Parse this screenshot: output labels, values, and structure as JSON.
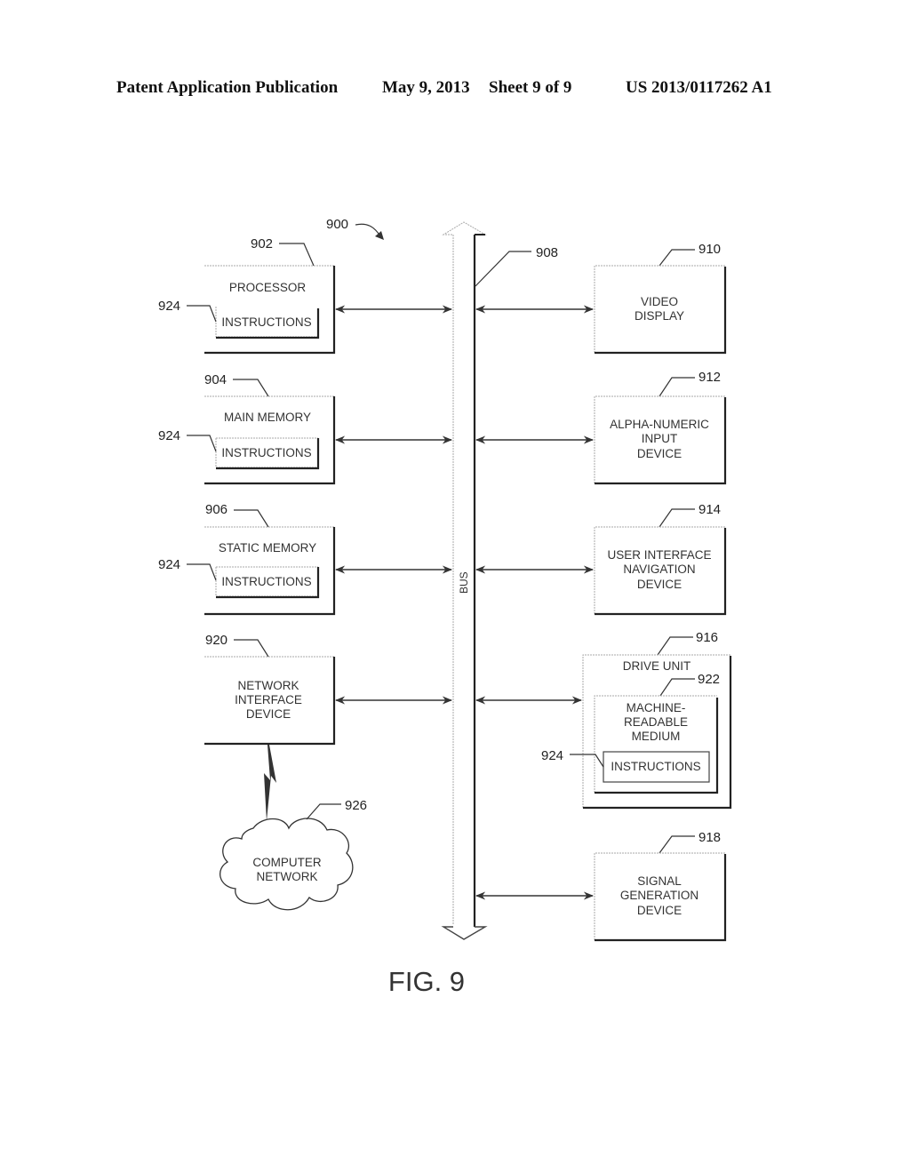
{
  "header": {
    "publication": "Patent Application Publication",
    "date": "May 9, 2013",
    "sheet": "Sheet 9 of 9",
    "number": "US 2013/0117262 A1"
  },
  "figure": {
    "caption": "FIG. 9",
    "system_ref": "900",
    "bus": {
      "label": "BUS",
      "ref": "908"
    },
    "left_blocks": [
      {
        "ref": "902",
        "title": [
          "PROCESSOR"
        ],
        "sub": {
          "ref": "924",
          "label": "INSTRUCTIONS"
        }
      },
      {
        "ref": "904",
        "title": [
          "MAIN MEMORY"
        ],
        "sub": {
          "ref": "924",
          "label": "INSTRUCTIONS"
        }
      },
      {
        "ref": "906",
        "title": [
          "STATIC MEMORY"
        ],
        "sub": {
          "ref": "924",
          "label": "INSTRUCTIONS"
        }
      },
      {
        "ref": "920",
        "title": [
          "NETWORK",
          "INTERFACE",
          "DEVICE"
        ]
      }
    ],
    "right_blocks": [
      {
        "ref": "910",
        "title": [
          "VIDEO",
          "DISPLAY"
        ]
      },
      {
        "ref": "912",
        "title": [
          "ALPHA-NUMERIC",
          "INPUT",
          "DEVICE"
        ]
      },
      {
        "ref": "914",
        "title": [
          "USER INTERFACE",
          "NAVIGATION",
          "DEVICE"
        ]
      },
      {
        "ref": "916",
        "title": [
          "DRIVE UNIT"
        ],
        "inner": {
          "ref": "922",
          "title": [
            "MACHINE-",
            "READABLE",
            "MEDIUM"
          ],
          "sub": {
            "ref": "924",
            "label": "INSTRUCTIONS"
          }
        }
      },
      {
        "ref": "918",
        "title": [
          "SIGNAL",
          "GENERATION",
          "DEVICE"
        ]
      }
    ],
    "network": {
      "ref": "926",
      "title": [
        "COMPUTER",
        "NETWORK"
      ]
    }
  }
}
